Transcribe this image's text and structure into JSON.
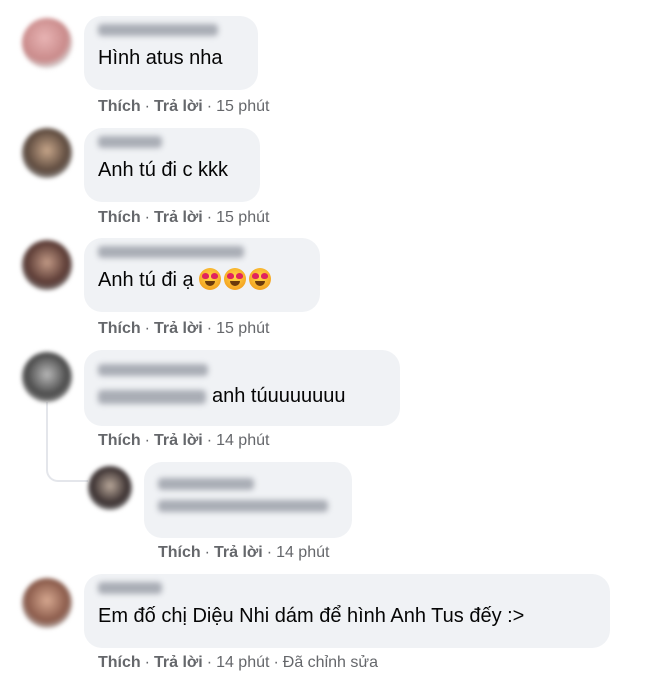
{
  "labels": {
    "like": "Thích",
    "reply": "Trả lời",
    "separator": "·",
    "edited": "Đã chỉnh sửa"
  },
  "comments": [
    {
      "text": "Hình atus nha",
      "time": "15 phút"
    },
    {
      "text": "Anh tú đi c kkk",
      "time": "15 phút"
    },
    {
      "text": "Anh tú đi ạ",
      "emojis": [
        "heart-eyes-emoji",
        "heart-eyes-emoji",
        "heart-eyes-emoji"
      ],
      "time": "15 phút"
    },
    {
      "text": "anh túuuuuuuu",
      "time": "14 phút"
    },
    {
      "text": "",
      "time": "14 phút"
    },
    {
      "text": "Em đố chị Diệu Nhi dám để hình Anh Tus đếy :>",
      "time": "14 phút"
    }
  ],
  "colors": {
    "bubble": "#f0f2f5",
    "text": "#050505",
    "meta": "#65676b"
  }
}
